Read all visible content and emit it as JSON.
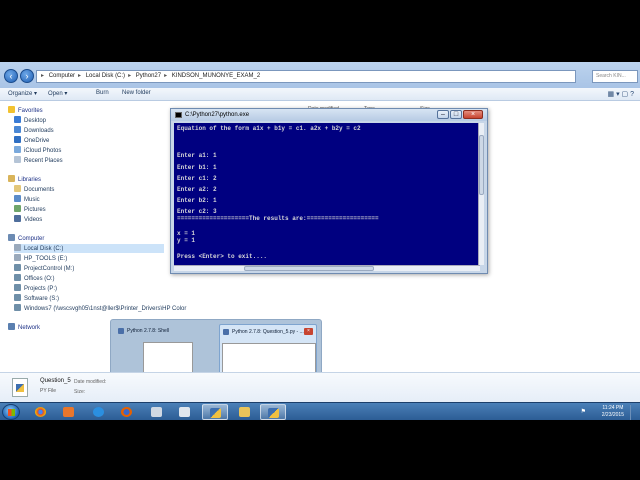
{
  "explorer": {
    "breadcrumb": [
      "Computer",
      "Local Disk (C:)",
      "Python27",
      "KINDSON_MUNONYE_EXAM_2"
    ],
    "search_placeholder": "Search KIN...",
    "toolbar": {
      "organize": "Organize ▾",
      "open": "Open ▾",
      "burn": "Burn",
      "new_folder": "New folder"
    },
    "columns": [
      "Date modified",
      "Type",
      "Size"
    ],
    "nav": {
      "favorites": "Favorites",
      "favorites_items": [
        "Desktop",
        "Downloads",
        "OneDrive",
        "iCloud Photos",
        "Recent Places"
      ],
      "libraries": "Libraries",
      "libraries_items": [
        "Documents",
        "Music",
        "Pictures",
        "Videos"
      ],
      "computer": "Computer",
      "computer_items": [
        "Local Disk (C:)",
        "HP_TOOLS (E:)",
        "ProjectControl (M:)",
        "Offices (O:)",
        "Projects (P:)",
        "Software (S:)",
        "Windows7 (\\\\wscsvgh05\\1nst@ller$\\Printer_Drivers\\HP Color"
      ],
      "network": "Network"
    },
    "details": {
      "name": "Question_5",
      "type": "PY File",
      "date_label": "Date modified:",
      "size_label": "Size:"
    }
  },
  "console": {
    "title": "C:\\Python27\\python.exe",
    "lines": [
      "Equation of the form a1x + b1y = c1. a2x + b2y = c2",
      "",
      "",
      "",
      "Enter a1: 1",
      "Enter b1: 1",
      "Enter c1: 2",
      "Enter a2: 2",
      "Enter b2: 1",
      "Enter c2: 3",
      "====================The results are:====================",
      "",
      "x = 1",
      "y = 1",
      "",
      "Press <Enter> to exit...."
    ]
  },
  "taskbar_preview": {
    "items": [
      "Python 2.7.8: Shell",
      "Python 2.7.8: Question_5.py - ..."
    ]
  },
  "taskbar": {
    "time": "11:24 PM",
    "date": "2/23/2015"
  },
  "colors": {
    "console_bg": "#000080",
    "taskbar": "#2c5d95"
  }
}
